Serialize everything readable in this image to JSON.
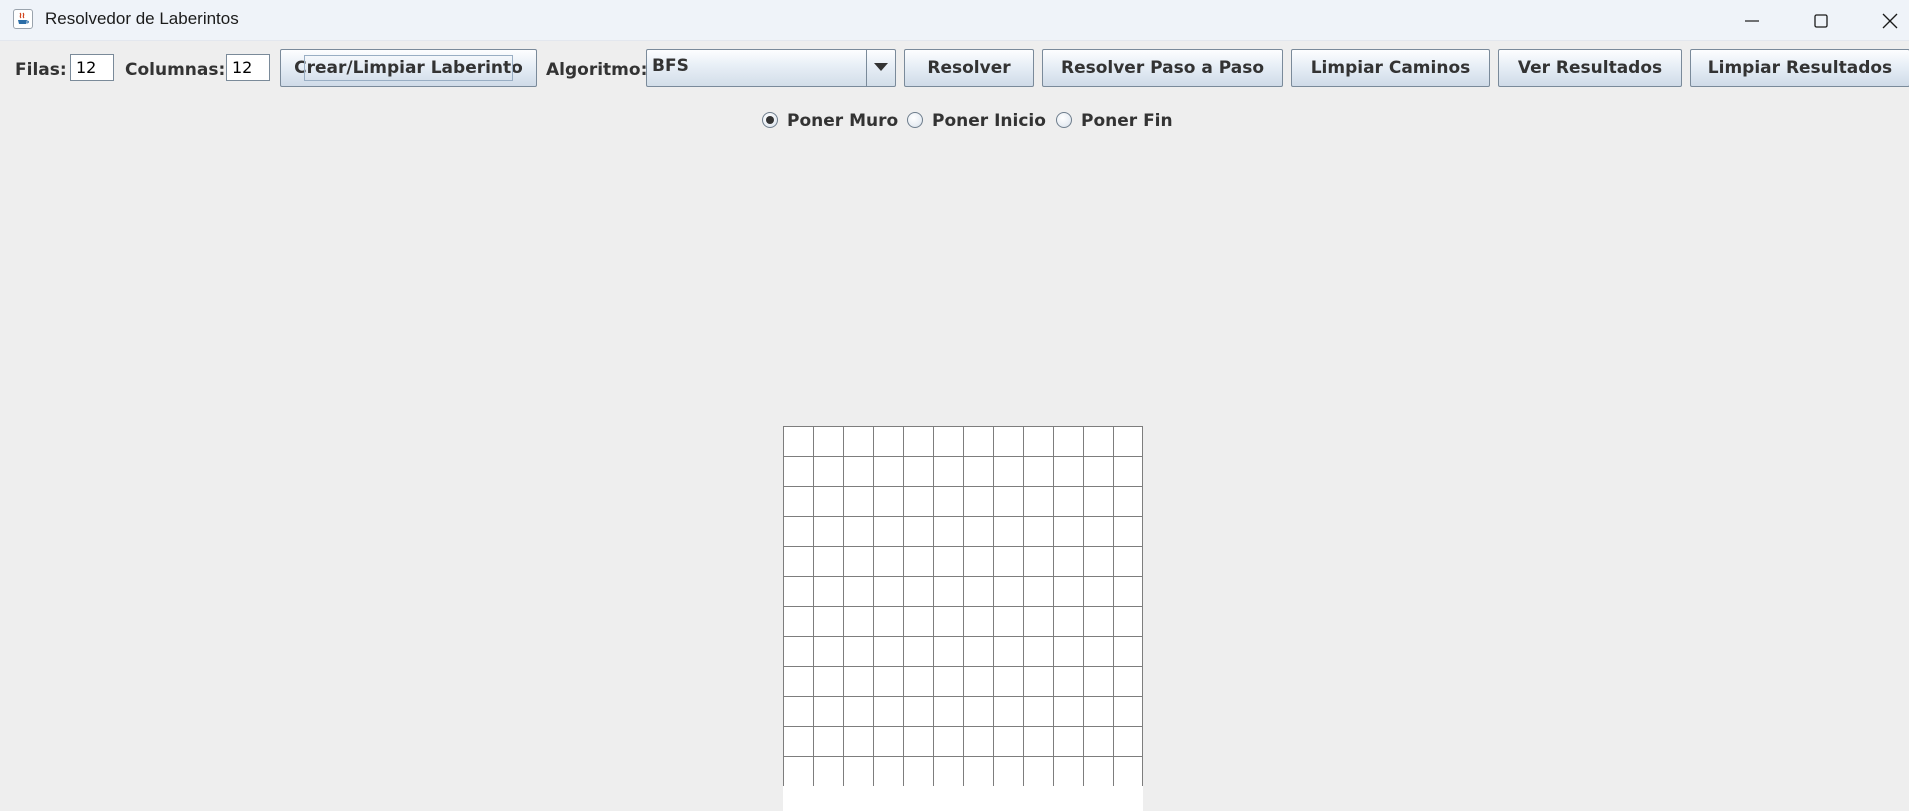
{
  "window": {
    "title": "Resolvedor de Laberintos",
    "controls": [
      "minimize-icon",
      "maximize-icon",
      "close-icon"
    ]
  },
  "toolbar": {
    "filas_label": "Filas:",
    "filas_value": "12",
    "columnas_label": "Columnas:",
    "columnas_value": "12",
    "crear_button": "Crear/Limpiar Laberinto",
    "algoritmo_label": "Algoritmo:",
    "algoritmo_value": "BFS",
    "resolver_button": "Resolver",
    "paso_button": "Resolver Paso a Paso",
    "limpiar_caminos_button": "Limpiar Caminos",
    "ver_resultados_button": "Ver Resultados",
    "limpiar_resultados_button": "Limpiar Resultados"
  },
  "mode": {
    "options": [
      "Poner Muro",
      "Poner Inicio",
      "Poner Fin"
    ],
    "selected": "Poner Muro"
  },
  "grid": {
    "rows": 12,
    "cols": 12
  },
  "colors": {
    "background": "#eeeeee",
    "cell": "#ffffff",
    "cell_border": "#7d7d7d"
  }
}
